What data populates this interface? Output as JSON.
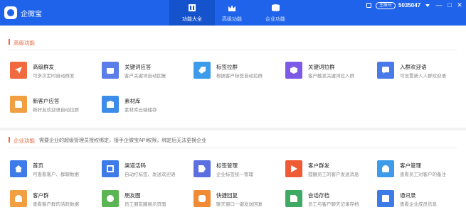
{
  "app": {
    "name": "企微宝"
  },
  "nav": {
    "tabs": [
      {
        "label": "功能大全",
        "icon": "grid-icon",
        "active": true
      },
      {
        "label": "高级功能",
        "icon": "crown-icon",
        "active": false
      },
      {
        "label": "企业功能",
        "icon": "book-icon",
        "active": false
      }
    ]
  },
  "account": {
    "badge": "主账号",
    "id": "5035047"
  },
  "window_controls": {
    "minimize": "—",
    "maximize": "□",
    "close": "✕"
  },
  "sections": {
    "advanced": {
      "title": "高级功能",
      "cards": [
        {
          "title": "高级群发",
          "desc": "可多次定时自动群发",
          "color": "#f0693f",
          "icon": "send-icon"
        },
        {
          "title": "关键词应答",
          "desc": "客户关键词自动回复",
          "color": "#5b7de8",
          "icon": "robot-icon"
        },
        {
          "title": "标签拉群",
          "desc": "根据客户标签自动拉群",
          "color": "#3d9be9",
          "icon": "tag-icon"
        },
        {
          "title": "关键词拉群",
          "desc": "客户触发关键词拉入群",
          "color": "#7e5be6",
          "icon": "hexagon-icon"
        },
        {
          "title": "入群欢迎语",
          "desc": "可设置新入人群欢迎语",
          "color": "#4a7ae8",
          "icon": "chat-icon"
        },
        {
          "title": "新客户应答",
          "desc": "新好友欢迎语自动拉群",
          "color": "#f0a043",
          "icon": "note-icon"
        },
        {
          "title": "素材库",
          "desc": "素材库云端储存",
          "color": "#3e8cea",
          "icon": "box-icon"
        }
      ]
    },
    "enterprise": {
      "title": "企业功能",
      "notice": "需要企业的超级管理员授权绑定，接手企微宝API权限，绑定后无法更换企业",
      "cards": [
        {
          "title": "首页",
          "desc": "可查看客户、群聊数据",
          "color": "#3d7be8",
          "icon": "home-icon"
        },
        {
          "title": "渠道活码",
          "desc": "自动打标签、发送欢迎语",
          "color": "#3d7be8",
          "icon": "qr-code-icon"
        },
        {
          "title": "标签管理",
          "desc": "企业标签统一管理",
          "color": "#5b6fe0",
          "icon": "label-icon"
        },
        {
          "title": "客户群发",
          "desc": "提醒员工的客户发送消息",
          "color": "#ee5b34",
          "icon": "play-icon"
        },
        {
          "title": "客户管理",
          "desc": "查看员工对客户的备注",
          "color": "#3d9be9",
          "icon": "user-icon"
        },
        {
          "title": "客户群",
          "desc": "查看客户群的活跃数据",
          "color": "#f0a043",
          "icon": "group-icon"
        },
        {
          "title": "朋友圈",
          "desc": "员工朋友圈展示页面",
          "color": "#5bb554",
          "icon": "moments-icon"
        },
        {
          "title": "快捷回复",
          "desc": "聊天窗口一键发送回复",
          "color": "#f08a35",
          "icon": "quick-reply-icon"
        },
        {
          "title": "会话存档",
          "desc": "员工与客户聊天记录存档",
          "color": "#3faa64",
          "icon": "archive-icon"
        },
        {
          "title": "通讯录",
          "desc": "查看企业成员信息",
          "color": "#3d7be8",
          "icon": "contacts-icon"
        }
      ]
    }
  }
}
